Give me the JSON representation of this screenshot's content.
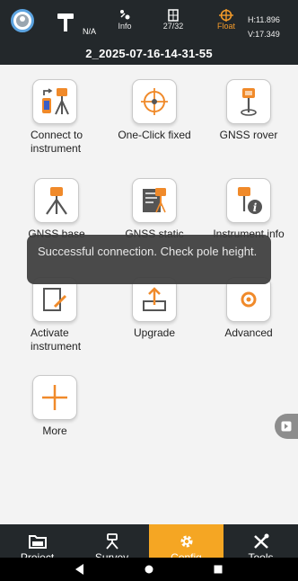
{
  "status": {
    "na": "N/A",
    "info": "Info",
    "satellites": "27/32",
    "solution": "Float",
    "h": "H:11.896",
    "v": "V:17.349",
    "filename": "2_2025-07-16-14-31-55"
  },
  "tiles": [
    {
      "label": "Connect to instrument",
      "icon": "phone-connect-icon"
    },
    {
      "label": "One-Click fixed",
      "icon": "crosshair-icon"
    },
    {
      "label": "GNSS rover",
      "icon": "rover-icon"
    },
    {
      "label": "GNSS base",
      "icon": "tripod-base-icon"
    },
    {
      "label": "GNSS static",
      "icon": "static-icon"
    },
    {
      "label": "Instrument info",
      "icon": "instrument-info-icon"
    },
    {
      "label": "Activate instrument",
      "icon": "activate-icon"
    },
    {
      "label": "Upgrade",
      "icon": "upgrade-icon"
    },
    {
      "label": "Advanced",
      "icon": "advanced-icon"
    },
    {
      "label": "More",
      "icon": "plus-icon"
    }
  ],
  "toast": "Successful connection. Check pole height.",
  "nav": [
    {
      "label": "Project",
      "icon": "folder-icon"
    },
    {
      "label": "Survey",
      "icon": "survey-icon"
    },
    {
      "label": "Config",
      "icon": "gear-icon",
      "active": true
    },
    {
      "label": "Tools",
      "icon": "tools-icon"
    }
  ],
  "colors": {
    "accent": "#f5a623",
    "bar": "#23282b",
    "float": "#f29a2a"
  }
}
